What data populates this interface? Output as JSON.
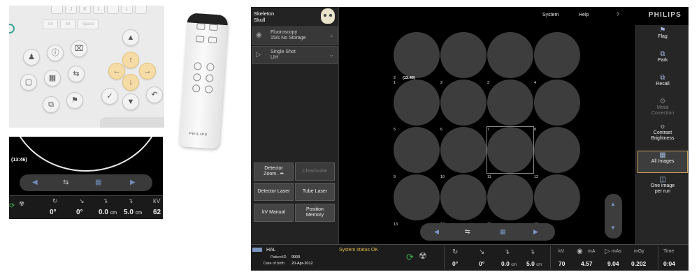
{
  "keypad": {
    "key_row": [
      "",
      "J",
      "K",
      "L",
      "",
      "L",
      ""
    ],
    "key_row2": [
      "Alt",
      "Alt",
      "Space"
    ]
  },
  "remote": {
    "brand": "PHILIPS"
  },
  "zoom_detail": {
    "time": "(13:46)",
    "status": [
      {
        "value": "0°"
      },
      {
        "value": "0°"
      },
      {
        "value": "0.0",
        "unit": "cm"
      },
      {
        "value": "5.0",
        "unit": "cm"
      },
      {
        "label": "kV",
        "value": "62"
      }
    ]
  },
  "header": {
    "exam_line1": "Skeleton",
    "exam_line2": "Skull",
    "menu": [
      "System",
      "Help",
      "?"
    ],
    "brand": "PHILIPS"
  },
  "left_panel": {
    "fluoro_line1": "Fluoroscopy",
    "fluoro_line2": "15/s No Storage",
    "shot_line1": "Single Shot",
    "shot_line2": "LIH",
    "buttons": [
      {
        "label1": "Detector",
        "label2": "Zoom . ••"
      },
      {
        "label1": "ClearGuide",
        "label2": ""
      },
      {
        "label1": "Detector Laser",
        "label2": ""
      },
      {
        "label1": "Tube Laser",
        "label2": ""
      },
      {
        "label1": "kV Manual",
        "label2": ""
      },
      {
        "label1": "Position",
        "label2": "Memory"
      }
    ]
  },
  "grid": {
    "cells": [
      "1",
      "2",
      "3",
      "4",
      "5",
      "6",
      "7",
      "8",
      "9",
      "10",
      "11",
      "12",
      "13",
      "14",
      "15",
      "16"
    ],
    "first_cell_number": "2",
    "first_cell_time": "(13:46)",
    "selected": "11"
  },
  "right_panel": {
    "items": [
      {
        "label1": "Flag",
        "label2": ""
      },
      {
        "label1": "Park",
        "label2": ""
      },
      {
        "label1": "Recall",
        "label2": ""
      },
      {
        "label1": "Metal",
        "label2": "Correction"
      },
      {
        "label1": "Contrast",
        "label2": "Brightness"
      },
      {
        "label1": "All Images",
        "label2": ""
      },
      {
        "label1": "One image",
        "label2": "per run"
      }
    ]
  },
  "status_bar": {
    "patient_name": "HAL",
    "patient_id_label": "PatientID",
    "patient_id": "9000",
    "dob_label": "Date of birth",
    "dob": "20-Apr-2012",
    "system_status": "System status OK",
    "angle1": "0°",
    "angle2": "0°",
    "dist1": "0.0",
    "dist1_unit": "cm",
    "dist2": "5.0",
    "dist2_unit": "cm",
    "kv_label": "kV",
    "kv": "70",
    "ma_label": "mA",
    "ma": "4.57",
    "mas_label": "mAs",
    "mas": "9.04",
    "mgy_label": "mGy",
    "mgy": "0.202",
    "time_label": "Time",
    "time": "0:04"
  },
  "colors": {
    "accent_blue": "#7a95c2",
    "status_ok": "#e0b84a",
    "selected_border": "#c8a35a",
    "ready_green": "#3fb34f"
  }
}
